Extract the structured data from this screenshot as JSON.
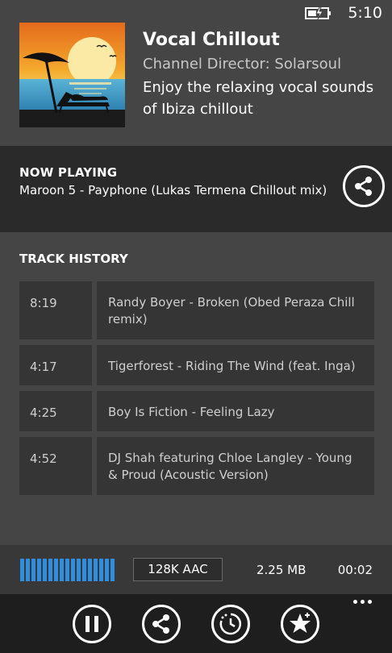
{
  "status_bar": {
    "time": "5:10",
    "battery_icon": "battery-charging-icon"
  },
  "channel": {
    "title": "Vocal Chillout",
    "director": "Channel Director: Solarsoul",
    "description": "Enjoy the relaxing vocal sounds of Ibiza chillout"
  },
  "now_playing": {
    "heading": "NOW PLAYING",
    "track": "Maroon 5 - Payphone (Lukas Termena Chillout mix)",
    "share_icon": "share-icon"
  },
  "history": {
    "heading": "TRACK HISTORY",
    "items": [
      {
        "time": "8:19",
        "title": "Randy Boyer - Broken (Obed Peraza Chill remix)"
      },
      {
        "time": "4:17",
        "title": "Tigerforest - Riding The Wind (feat. Inga)"
      },
      {
        "time": "4:25",
        "title": "Boy Is Fiction - Feeling Lazy"
      },
      {
        "time": "4:52",
        "title": "DJ Shah featuring Chloe Langley - Young & Proud (Acoustic Version)"
      }
    ]
  },
  "player": {
    "level": 1.0,
    "bitrate": "128K AAC",
    "size": "2.25 MB",
    "elapsed": "00:02"
  },
  "app_bar": {
    "buttons": [
      "pause-icon",
      "share-icon",
      "sleep-timer-icon",
      "favorite-star-icon"
    ],
    "more_icon": "more-dots-icon"
  },
  "colors": {
    "accent": "#2f8ee0",
    "background": "#454545",
    "panel": "#2a2a2a",
    "app_bar": "#1e1e1e"
  }
}
